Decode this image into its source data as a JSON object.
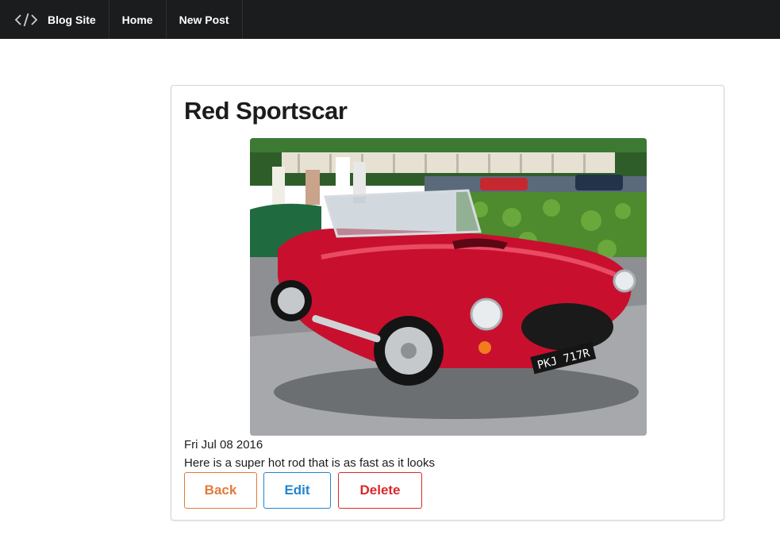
{
  "nav": {
    "brand": "Blog Site",
    "brand_icon": "code-icon",
    "items": [
      {
        "label": "Home"
      },
      {
        "label": "New Post"
      }
    ]
  },
  "post": {
    "title": "Red Sportscar",
    "image_alt": "red-sportscar-photo",
    "date": "Fri Jul 08 2016",
    "body": "Here is a super hot rod that is as fast as it looks",
    "plate": "PKJ 717R"
  },
  "actions": {
    "back_label": "Back",
    "edit_label": "Edit",
    "delete_label": "Delete"
  },
  "colors": {
    "navbar": "#1b1c1d",
    "back": "#e07b39",
    "edit": "#2185d0",
    "delete": "#db2828",
    "car": "#c8102e"
  }
}
